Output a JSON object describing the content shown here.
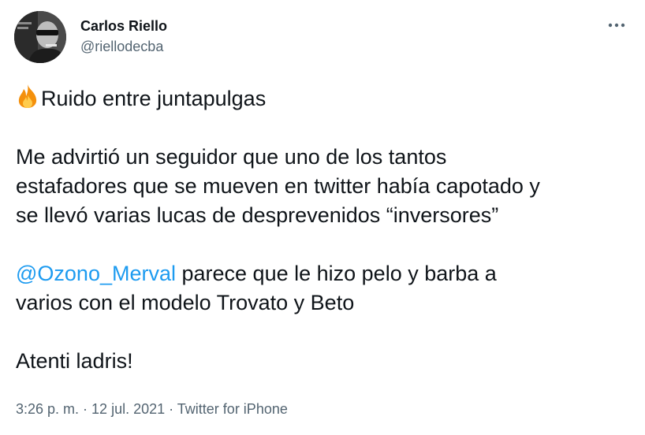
{
  "author": {
    "display_name": "Carlos Riello",
    "handle": "@riellodecba"
  },
  "icons": {
    "menu": "more-horizontal-icon",
    "emoji": "fire-emoji-icon"
  },
  "tweet": {
    "title_text": "Ruido entre juntapulgas",
    "para1_line1": "Me advirtió un seguidor que uno de los tantos",
    "para1_line2": "estafadores que se mueven en twitter había capotado y",
    "para1_line3": "se llevó varias lucas de desprevenidos “inversores”",
    "mention": "@Ozono_Merval",
    "para2_line1_rest": " parece que le hizo pelo y barba a",
    "para2_line2": "varios con el modelo Trovato y Beto",
    "para3": "Atenti ladris!"
  },
  "meta": {
    "time": "3:26 p. m.",
    "sep": " · ",
    "date": "12 jul. 2021",
    "source": "Twitter for iPhone"
  },
  "colors": {
    "accent": "#1d9bf0",
    "secondary_text": "#536471",
    "primary_text": "#0f1419"
  }
}
